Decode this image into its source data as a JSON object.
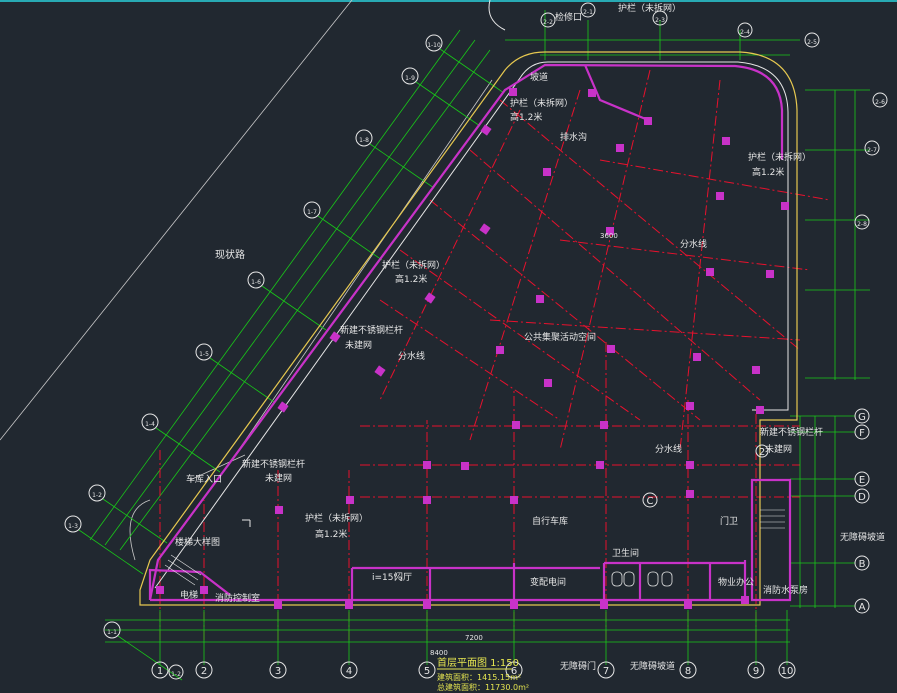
{
  "drawing": {
    "title": "首层平面图 1:150",
    "note_area": "建筑面积：1415.15m²",
    "note_total": "总建筑面积：11730.0m²",
    "colors": {
      "background": "#212830",
      "grid": "#e8112d",
      "dim": "#19c819",
      "wall": "#e6e6e6",
      "column": "#c832c8",
      "label": "#e6e650",
      "outline": "#e6c850"
    }
  },
  "axis_x": [
    "1",
    "2",
    "3",
    "4",
    "5",
    "6",
    "7",
    "8",
    "9",
    "10"
  ],
  "axis_x_extra": [
    "1-2"
  ],
  "axis_y_right": [
    "A",
    "B",
    "C",
    "D",
    "E",
    "F",
    "G"
  ],
  "axis_y_extra": [
    "2"
  ],
  "axis_diag_left": [
    "1-1",
    "1-2",
    "1-3",
    "1-4",
    "1-5",
    "1-6",
    "1-7",
    "1-8",
    "1-9",
    "1-10"
  ],
  "axis_top": [
    "2-1",
    "2-2",
    "2-3",
    "2-4",
    "2-5",
    "2-6",
    "2-7",
    "2-8"
  ],
  "labels": {
    "road": "现状路",
    "entrance_car": "车库入口",
    "stair_lobby": "楼梯大样图",
    "railing_new": "新建不锈钢栏杆",
    "railing_unbuilt": "未建网",
    "post_existing": "护栏（未拆网）",
    "height_12": "高1.2米",
    "water_line": "分水线",
    "public_space": "公共集聚活动空间",
    "elevator_left": "电梯",
    "control_room": "消防控制室",
    "electric_room": "变配电间",
    "toilet_wc": "卫生间",
    "office": "物业办公",
    "fire_room": "消防水泵房",
    "main_door": "无障碍门",
    "barrier_free": "无障碍坡道",
    "ramp_top": "坡道",
    "drain": "排水沟",
    "hatch": "检修口",
    "car_ramp": "i=15%",
    "rooms_entry": "门厅",
    "bike": "自行车库",
    "guard": "门卫",
    "dim_total": "8400",
    "dim_mid": "7200",
    "dim_small": "3600"
  }
}
